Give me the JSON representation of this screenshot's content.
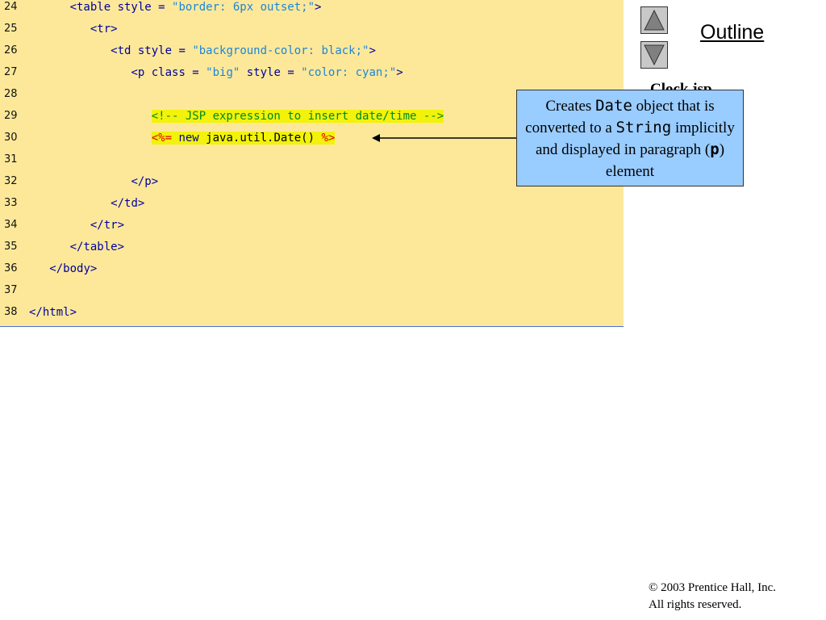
{
  "code": {
    "lines": [
      {
        "num": "24",
        "parts": [
          {
            "t": "      ",
            "c": "black"
          },
          {
            "t": "<table style = ",
            "c": "tag"
          },
          {
            "t": "\"border: 6px outset;\"",
            "c": "str"
          },
          {
            "t": ">",
            "c": "tag"
          }
        ]
      },
      {
        "num": "25",
        "parts": [
          {
            "t": "         ",
            "c": "black"
          },
          {
            "t": "<tr>",
            "c": "tag"
          }
        ]
      },
      {
        "num": "26",
        "parts": [
          {
            "t": "            ",
            "c": "black"
          },
          {
            "t": "<td style = ",
            "c": "tag"
          },
          {
            "t": "\"background-color: black;\"",
            "c": "str"
          },
          {
            "t": ">",
            "c": "tag"
          }
        ]
      },
      {
        "num": "27",
        "parts": [
          {
            "t": "               ",
            "c": "black"
          },
          {
            "t": "<p class = ",
            "c": "tag"
          },
          {
            "t": "\"big\"",
            "c": "str"
          },
          {
            "t": " style = ",
            "c": "tag"
          },
          {
            "t": "\"color: cyan;\"",
            "c": "str"
          },
          {
            "t": ">",
            "c": "tag"
          }
        ]
      },
      {
        "num": "28",
        "parts": []
      },
      {
        "num": "29",
        "parts": [
          {
            "t": "                  ",
            "c": "black"
          },
          {
            "t": "<!-- JSP expression to insert date/time -->",
            "c": "hl-green"
          }
        ]
      },
      {
        "num": "30",
        "parts": [
          {
            "t": "                  ",
            "c": "black"
          },
          {
            "t": "<%=",
            "c": "hl-red"
          },
          {
            "t": " ",
            "c": "hl-plain"
          },
          {
            "t": "new",
            "c": "hl-blue"
          },
          {
            "t": " java.util.Date() ",
            "c": "hl-plain"
          },
          {
            "t": "%>",
            "c": "hl-red"
          }
        ]
      },
      {
        "num": "31",
        "parts": []
      },
      {
        "num": "32",
        "parts": [
          {
            "t": "               ",
            "c": "black"
          },
          {
            "t": "</p>",
            "c": "tag"
          }
        ]
      },
      {
        "num": "33",
        "parts": [
          {
            "t": "            ",
            "c": "black"
          },
          {
            "t": "</td>",
            "c": "tag"
          }
        ]
      },
      {
        "num": "34",
        "parts": [
          {
            "t": "         ",
            "c": "black"
          },
          {
            "t": "</tr>",
            "c": "tag"
          }
        ]
      },
      {
        "num": "35",
        "parts": [
          {
            "t": "      ",
            "c": "black"
          },
          {
            "t": "</table>",
            "c": "tag"
          }
        ]
      },
      {
        "num": "36",
        "parts": [
          {
            "t": "   ",
            "c": "black"
          },
          {
            "t": "</body>",
            "c": "tag"
          }
        ]
      },
      {
        "num": "37",
        "parts": []
      },
      {
        "num": "38",
        "parts": [
          {
            "t": "</html>",
            "c": "tag"
          }
        ]
      }
    ]
  },
  "nav": {
    "up_icon": "triangle-up-icon",
    "down_icon": "triangle-down-icon",
    "outline_label": "Outline"
  },
  "behind_text": "Clock.jsp",
  "callout": {
    "t1": "Creates ",
    "m1": "Date",
    "t2": " object that is converted to a ",
    "m2": "String",
    "t3": " implicitly and displayed in paragraph (",
    "m3": "p",
    "t4": ") element"
  },
  "footer": {
    "copyright_symbol": "©",
    "line1": " 2003 Prentice Hall, Inc.",
    "line2": "All rights reserved."
  },
  "colors": {
    "code_background": "#fde89a",
    "callout_background": "#99ccff",
    "highlight": "#f2f20a",
    "tag_color": "#00009c",
    "string_color": "#1b86d8",
    "comment_color": "#008a1e",
    "jsp_delim_color": "#e10000"
  }
}
